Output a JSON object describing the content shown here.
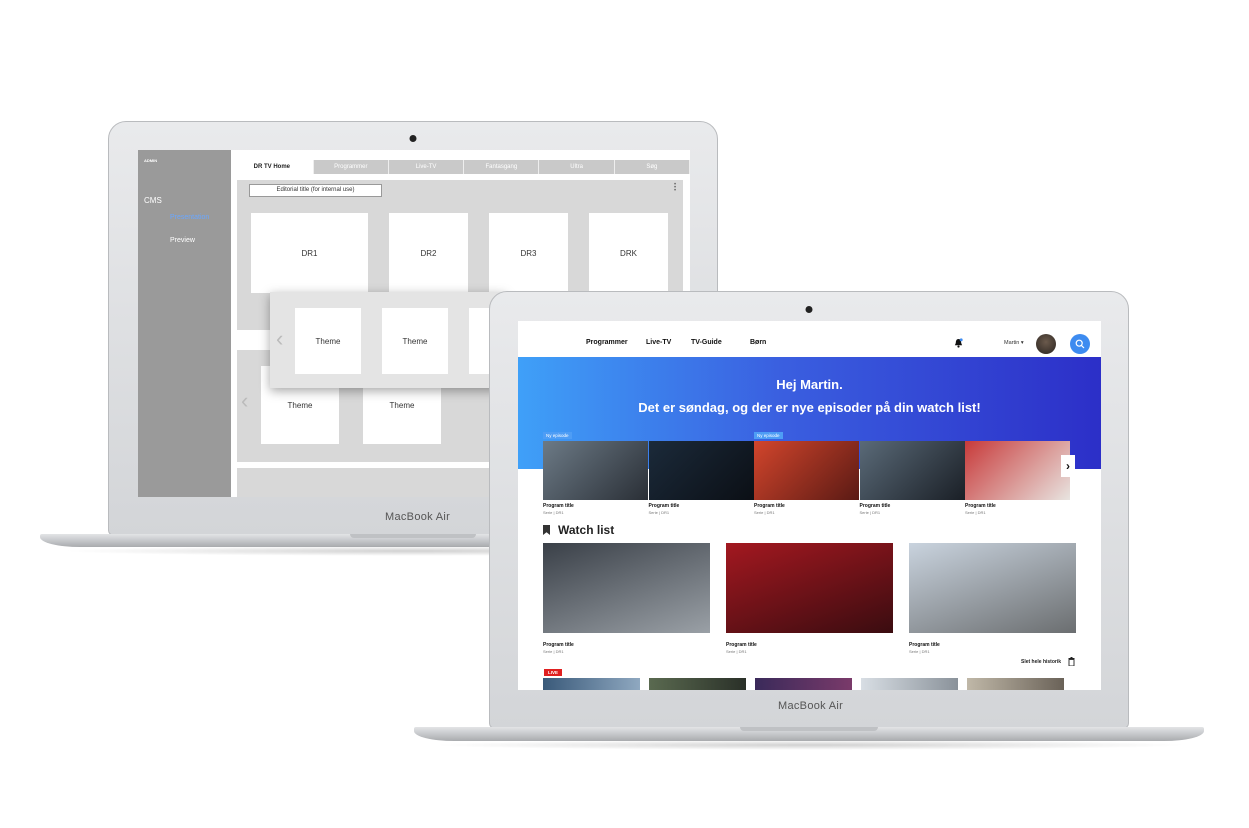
{
  "devices": {
    "brand": "MacBook Air"
  },
  "cms": {
    "logo": "ADMIN",
    "section": "CMS",
    "nav": [
      {
        "label": "Presentation",
        "active": true
      },
      {
        "label": "Preview",
        "active": false
      }
    ],
    "tabs": [
      "DR TV Home",
      "Programmer",
      "Live-TV",
      "Fantasgang",
      "Ultra",
      "Søg"
    ],
    "editorial_title": "Editorial title (for internal use)",
    "channels": [
      "DR1",
      "DR2",
      "DR3",
      "DRK"
    ],
    "theme_label": "Theme",
    "menu_icon": "kebab-icon",
    "prev_icon": "chevron-left-icon"
  },
  "tv": {
    "nav": [
      "Programmer",
      "Live-TV",
      "TV-Guide",
      "Børn"
    ],
    "user_name": "Martin",
    "greeting": "Hej Martin.",
    "subline": "Det er søndag, og der er nye episoder på din watch list!",
    "new_episode_badge": "Ny episode",
    "episodes": [
      {
        "title": "Program title",
        "subtitle": "Serie | DR1",
        "badge": true,
        "color_a": "#6c7a86",
        "color_b": "#2a2f36"
      },
      {
        "title": "Program title",
        "subtitle": "Serie | DR1",
        "badge": false,
        "color_a": "#1b2a3a",
        "color_b": "#0b0f15"
      },
      {
        "title": "Program title",
        "subtitle": "Serie | DR1",
        "badge": true,
        "color_a": "#d2452c",
        "color_b": "#5a1a14"
      },
      {
        "title": "Program title",
        "subtitle": "Serie | DR1",
        "badge": false,
        "color_a": "#5a6a78",
        "color_b": "#1a1f26"
      },
      {
        "title": "Program title",
        "subtitle": "Serie | DR1",
        "badge": false,
        "color_a": "#c83a3a",
        "color_b": "#e8e4e0"
      }
    ],
    "watchlist_title": "Watch list",
    "watchlist": [
      {
        "title": "Program title",
        "subtitle": "Serie | DR1",
        "color_a": "#3a4048",
        "color_b": "#9aa0a6"
      },
      {
        "title": "Program title",
        "subtitle": "Serie | DR1",
        "color_a": "#a31820",
        "color_b": "#3a0c10"
      },
      {
        "title": "Program title",
        "subtitle": "Serie | DR1",
        "color_a": "#c9d3de",
        "color_b": "#6b6e70"
      }
    ],
    "history_label": "Slet hele historik",
    "live_badge": "LIVE",
    "colors": {
      "accent": "#3d8bf0",
      "hero_start": "#3fa0f8",
      "hero_end": "#2c2fc8",
      "live": "#e02020"
    }
  }
}
